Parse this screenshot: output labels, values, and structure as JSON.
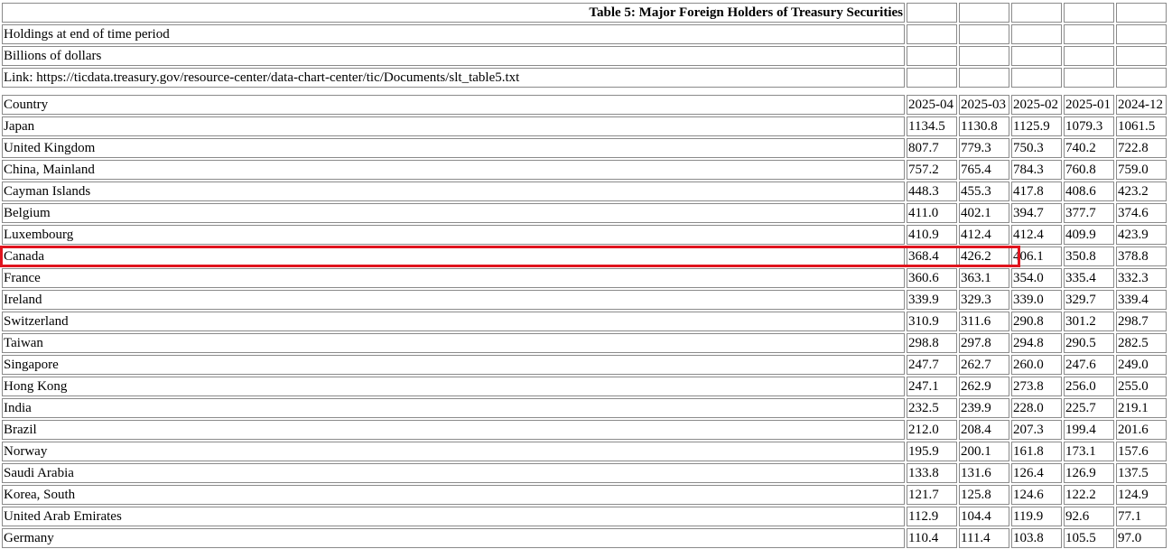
{
  "table_title": "Table 5: Major Foreign Holders of Treasury Securities",
  "subtitle_holdings": "Holdings at end of time period",
  "subtitle_units": "Billions of dollars",
  "link_text": "Link: https://ticdata.treasury.gov/resource-center/data-chart-center/tic/Documents/slt_table5.txt",
  "header": {
    "country": "Country",
    "periods": [
      "2025-04",
      "2025-03",
      "2025-02",
      "2025-01",
      "2024-12"
    ]
  },
  "rows": [
    {
      "country": "Japan",
      "values": [
        "1134.5",
        "1130.8",
        "1125.9",
        "1079.3",
        "1061.5"
      ]
    },
    {
      "country": "United Kingdom",
      "values": [
        "807.7",
        "779.3",
        "750.3",
        "740.2",
        "722.8"
      ]
    },
    {
      "country": "China, Mainland",
      "values": [
        "757.2",
        "765.4",
        "784.3",
        "760.8",
        "759.0"
      ]
    },
    {
      "country": "Cayman Islands",
      "values": [
        "448.3",
        "455.3",
        "417.8",
        "408.6",
        "423.2"
      ]
    },
    {
      "country": "Belgium",
      "values": [
        "411.0",
        "402.1",
        "394.7",
        "377.7",
        "374.6"
      ]
    },
    {
      "country": "Luxembourg",
      "values": [
        "410.9",
        "412.4",
        "412.4",
        "409.9",
        "423.9"
      ]
    },
    {
      "country": "Canada",
      "values": [
        "368.4",
        "426.2",
        "406.1",
        "350.8",
        "378.8"
      ]
    },
    {
      "country": "France",
      "values": [
        "360.6",
        "363.1",
        "354.0",
        "335.4",
        "332.3"
      ]
    },
    {
      "country": "Ireland",
      "values": [
        "339.9",
        "329.3",
        "339.0",
        "329.7",
        "339.4"
      ]
    },
    {
      "country": "Switzerland",
      "values": [
        "310.9",
        "311.6",
        "290.8",
        "301.2",
        "298.7"
      ]
    },
    {
      "country": "Taiwan",
      "values": [
        "298.8",
        "297.8",
        "294.8",
        "290.5",
        "282.5"
      ]
    },
    {
      "country": "Singapore",
      "values": [
        "247.7",
        "262.7",
        "260.0",
        "247.6",
        "249.0"
      ]
    },
    {
      "country": "Hong Kong",
      "values": [
        "247.1",
        "262.9",
        "273.8",
        "256.0",
        "255.0"
      ]
    },
    {
      "country": "India",
      "values": [
        "232.5",
        "239.9",
        "228.0",
        "225.7",
        "219.1"
      ]
    },
    {
      "country": "Brazil",
      "values": [
        "212.0",
        "208.4",
        "207.3",
        "199.4",
        "201.6"
      ]
    },
    {
      "country": "Norway",
      "values": [
        "195.9",
        "200.1",
        "161.8",
        "173.1",
        "157.6"
      ]
    },
    {
      "country": "Saudi Arabia",
      "values": [
        "133.8",
        "131.6",
        "126.4",
        "126.9",
        "137.5"
      ]
    },
    {
      "country": "Korea, South",
      "values": [
        "121.7",
        "125.8",
        "124.6",
        "122.2",
        "124.9"
      ]
    },
    {
      "country": "United Arab Emirates",
      "values": [
        "112.9",
        "104.4",
        "119.9",
        "92.6",
        "77.1"
      ]
    },
    {
      "country": "Germany",
      "values": [
        "110.4",
        "111.4",
        "103.8",
        "105.5",
        "97.0"
      ]
    }
  ],
  "highlight": {
    "row_country": "Canada",
    "color": "#e0141e"
  }
}
